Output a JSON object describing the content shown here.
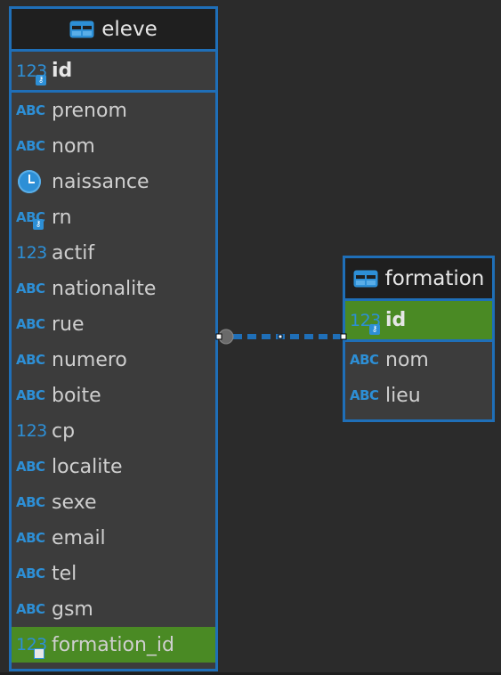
{
  "colors": {
    "background": "#2b2b2b",
    "entity_border": "#1f6fb8",
    "entity_body": "#3c3c3c",
    "header_bg": "#1f1f1f",
    "highlight": "#4a8a24",
    "type_icon": "#2d8fd6"
  },
  "entities": [
    {
      "name": "eleve",
      "icon": "table-icon",
      "primary_key": {
        "name": "id",
        "type_icon": "123",
        "key_icon": "primary-key-icon"
      },
      "attributes": [
        {
          "name": "prenom",
          "type_icon": "ABC"
        },
        {
          "name": "nom",
          "type_icon": "ABC"
        },
        {
          "name": "naissance",
          "type_icon": "clock-icon"
        },
        {
          "name": "rn",
          "type_icon": "ABC",
          "key_icon": "unique-key-icon"
        },
        {
          "name": "actif",
          "type_icon": "123"
        },
        {
          "name": "nationalite",
          "type_icon": "ABC"
        },
        {
          "name": "rue",
          "type_icon": "ABC"
        },
        {
          "name": "numero",
          "type_icon": "ABC"
        },
        {
          "name": "boite",
          "type_icon": "ABC"
        },
        {
          "name": "cp",
          "type_icon": "123"
        },
        {
          "name": "localite",
          "type_icon": "ABC"
        },
        {
          "name": "sexe",
          "type_icon": "ABC"
        },
        {
          "name": "email",
          "type_icon": "ABC"
        },
        {
          "name": "tel",
          "type_icon": "ABC"
        },
        {
          "name": "gsm",
          "type_icon": "ABC"
        },
        {
          "name": "formation_id",
          "type_icon": "123",
          "key_icon": "foreign-key-icon",
          "highlighted": true
        }
      ]
    },
    {
      "name": "formation",
      "icon": "table-icon",
      "primary_key": {
        "name": "id",
        "type_icon": "123",
        "key_icon": "primary-key-icon",
        "highlighted": true
      },
      "attributes": [
        {
          "name": "nom",
          "type_icon": "ABC"
        },
        {
          "name": "lieu",
          "type_icon": "ABC"
        }
      ]
    }
  ],
  "relationship": {
    "from": "eleve.formation_id",
    "to": "formation.id",
    "style": "dashed"
  }
}
